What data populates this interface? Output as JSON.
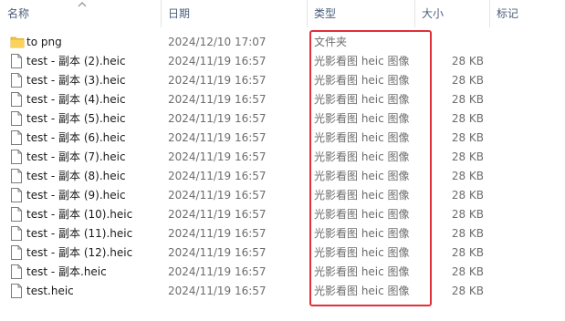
{
  "columns": {
    "name": "名称",
    "date": "日期",
    "type": "类型",
    "size": "大小",
    "tags": "标记"
  },
  "files": [
    {
      "name": "to png",
      "date": "2024/12/10 17:07",
      "type": "文件夹",
      "size": "",
      "icon": "folder-icon"
    },
    {
      "name": "test - 副本 (2).heic",
      "date": "2024/11/19 16:57",
      "type": "光影看图 heic 图像",
      "size": "28 KB",
      "icon": "file-icon"
    },
    {
      "name": "test - 副本 (3).heic",
      "date": "2024/11/19 16:57",
      "type": "光影看图 heic 图像",
      "size": "28 KB",
      "icon": "file-icon"
    },
    {
      "name": "test - 副本 (4).heic",
      "date": "2024/11/19 16:57",
      "type": "光影看图 heic 图像",
      "size": "28 KB",
      "icon": "file-icon"
    },
    {
      "name": "test - 副本 (5).heic",
      "date": "2024/11/19 16:57",
      "type": "光影看图 heic 图像",
      "size": "28 KB",
      "icon": "file-icon"
    },
    {
      "name": "test - 副本 (6).heic",
      "date": "2024/11/19 16:57",
      "type": "光影看图 heic 图像",
      "size": "28 KB",
      "icon": "file-icon"
    },
    {
      "name": "test - 副本 (7).heic",
      "date": "2024/11/19 16:57",
      "type": "光影看图 heic 图像",
      "size": "28 KB",
      "icon": "file-icon"
    },
    {
      "name": "test - 副本 (8).heic",
      "date": "2024/11/19 16:57",
      "type": "光影看图 heic 图像",
      "size": "28 KB",
      "icon": "file-icon"
    },
    {
      "name": "test - 副本 (9).heic",
      "date": "2024/11/19 16:57",
      "type": "光影看图 heic 图像",
      "size": "28 KB",
      "icon": "file-icon"
    },
    {
      "name": "test - 副本 (10).heic",
      "date": "2024/11/19 16:57",
      "type": "光影看图 heic 图像",
      "size": "28 KB",
      "icon": "file-icon"
    },
    {
      "name": "test - 副本 (11).heic",
      "date": "2024/11/19 16:57",
      "type": "光影看图 heic 图像",
      "size": "28 KB",
      "icon": "file-icon"
    },
    {
      "name": "test - 副本 (12).heic",
      "date": "2024/11/19 16:57",
      "type": "光影看图 heic 图像",
      "size": "28 KB",
      "icon": "file-icon"
    },
    {
      "name": "test - 副本.heic",
      "date": "2024/11/19 16:57",
      "type": "光影看图 heic 图像",
      "size": "28 KB",
      "icon": "file-icon"
    },
    {
      "name": "test.heic",
      "date": "2024/11/19 16:57",
      "type": "光影看图 heic 图像",
      "size": "28 KB",
      "icon": "file-icon"
    }
  ],
  "colors": {
    "highlight_border": "#e0303a",
    "folder": "#f5c342",
    "header_text": "#4c5f7a"
  }
}
